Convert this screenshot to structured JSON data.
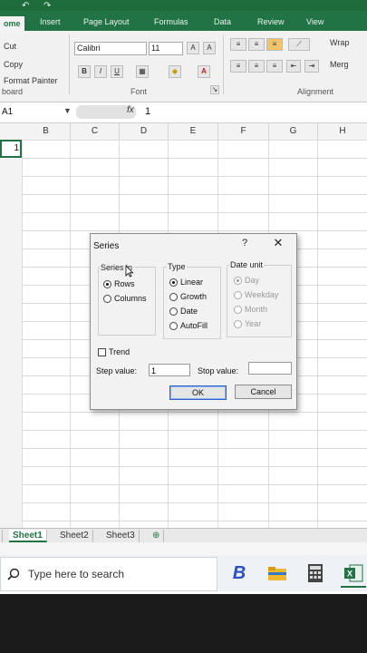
{
  "title_bar": {
    "quick_access": [
      "↶",
      "↷"
    ]
  },
  "tabs": [
    {
      "label": "Home",
      "display": "ome",
      "active": true
    },
    {
      "label": "Insert"
    },
    {
      "label": "Page Layout"
    },
    {
      "label": "Formulas"
    },
    {
      "label": "Data"
    },
    {
      "label": "Review"
    },
    {
      "label": "View"
    }
  ],
  "clipboard": {
    "cut": "Cut",
    "copy": "Copy",
    "format_painter": "Format Painter",
    "group": "board"
  },
  "font": {
    "name": "Calibri",
    "size": "11",
    "group": "Font",
    "bold": "B",
    "italic": "I",
    "underline": "U"
  },
  "alignment": {
    "wrap": "Wrap",
    "merge": "Merg",
    "group": "Alignment"
  },
  "formula_bar": {
    "name_box": "A1",
    "fx": "fx",
    "value": "1"
  },
  "columns": [
    "B",
    "C",
    "D",
    "E",
    "F",
    "G",
    "H"
  ],
  "active_cell_value": "1",
  "sheets": [
    {
      "name": "Sheet1",
      "active": true
    },
    {
      "name": "Sheet2"
    },
    {
      "name": "Sheet3"
    }
  ],
  "taskbar": {
    "search_placeholder": "Type here to search"
  },
  "dialog": {
    "title": "Series",
    "help": "?",
    "close": "✕",
    "series_in": {
      "label": "Series in",
      "options": [
        "Rows",
        "Columns"
      ],
      "selected": "Rows"
    },
    "type": {
      "label": "Type",
      "options": [
        "Linear",
        "Growth",
        "Date",
        "AutoFill"
      ],
      "selected": "Linear"
    },
    "date_unit": {
      "label": "Date unit",
      "options": [
        "Day",
        "Weekday",
        "Month",
        "Year"
      ],
      "selected": "Day",
      "disabled": true
    },
    "trend": {
      "label": "Trend",
      "checked": false
    },
    "step_value": {
      "label": "Step value:",
      "value": "1"
    },
    "stop_value": {
      "label": "Stop value:",
      "value": ""
    },
    "ok": "OK",
    "cancel": "Cancel"
  },
  "colors": {
    "excel_green": "#217346",
    "ribbon": "#f1f1f1",
    "taskbar": "#eef2f7"
  }
}
